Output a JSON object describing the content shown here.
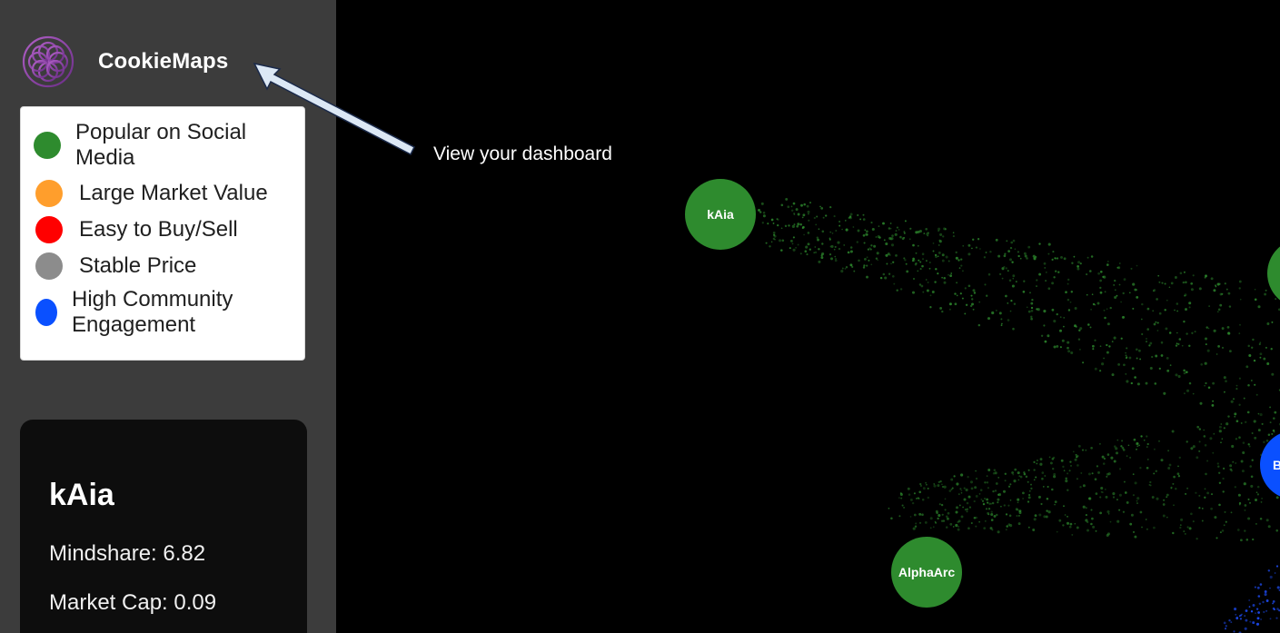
{
  "brand": {
    "name": "CookieMaps"
  },
  "legend": {
    "items": [
      {
        "label": "Popular on Social Media",
        "color": "#2e8b2e"
      },
      {
        "label": "Large Market Value",
        "color": "#ff9e2c"
      },
      {
        "label": "Easy to Buy/Sell",
        "color": "#ff0000"
      },
      {
        "label": "Stable Price",
        "color": "#8c8c8c"
      },
      {
        "label": "High Community Engagement",
        "color": "#0a50ff"
      }
    ]
  },
  "details": {
    "name": "kAia",
    "mindshare": "Mindshare: 6.82",
    "market_cap": "Market Cap: 0.09"
  },
  "tour": {
    "text": "View your dashboard"
  },
  "map": {
    "nodes": [
      {
        "label": "kAia",
        "color": "#2e8b2e"
      },
      {
        "label": "AlphaArc",
        "color": "#2e8b2e"
      },
      {
        "label": "",
        "color": "#2e8b2e"
      },
      {
        "label": "B",
        "color": "#0a50ff"
      }
    ]
  }
}
